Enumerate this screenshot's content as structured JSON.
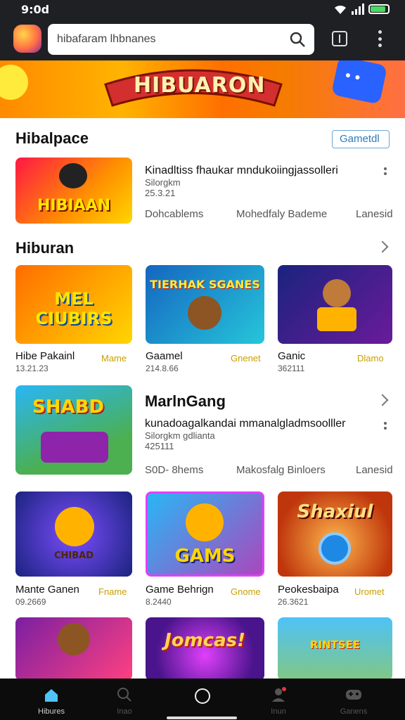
{
  "status_bar": {
    "time": "9:0d"
  },
  "search": {
    "value": "hibafaram lhbnanes"
  },
  "hero": {
    "title": "HIBUARON"
  },
  "section1": {
    "title": "Hibalpace",
    "action_label": "Gametdl",
    "featured": {
      "thumb_text": "HIBIAAN",
      "title": "Kinadltiss fhaukar mndukoiingjassolleri",
      "subtitle": "Silorgkm",
      "meta": "25.3.21",
      "stats": [
        "Dohcablems",
        "Mohedfaly Bademe",
        "Lanesid"
      ]
    }
  },
  "section2": {
    "title": "Hiburan",
    "cards": [
      {
        "thumb_text": "MEL CIUBIRS",
        "name": "Hibe Pakainl",
        "meta": "13.21.23",
        "tag": "Mame",
        "bg": "#ff6d00"
      },
      {
        "thumb_text": "TIERHAK SGANES",
        "name": "Gaamel",
        "meta": "214.8.66",
        "tag": "Gnenet",
        "bg": "#1e88e5"
      },
      {
        "thumb_text": "",
        "name": "Ganic",
        "meta": "362111",
        "tag": "Dlamo",
        "bg": "#283593"
      }
    ]
  },
  "section3": {
    "title": "MarlnGang",
    "featured": {
      "thumb_text": "SHABD",
      "title": "kunadoagalkandai mmanalgladmsoolller",
      "subtitle": "Silorgkm gdlianta",
      "meta": "425111",
      "stats": [
        "S0D- 8hems",
        "Makosfalg Binloers",
        "Lanesid"
      ]
    }
  },
  "section4": {
    "cards": [
      {
        "thumb_text": "CHIBAD",
        "name": "Mante Ganen",
        "meta": "09.2669",
        "tag": "Fname",
        "bg": "#3949ab"
      },
      {
        "thumb_text": "GAMS",
        "name": "Game Behrign",
        "meta": "8.2440",
        "tag": "Gnome",
        "bg": "#29b6f6"
      },
      {
        "thumb_text": "Shaxiul",
        "name": "Peokesbaipa",
        "meta": "26.3621",
        "tag": "Uromet",
        "bg": "#e64a19"
      }
    ]
  },
  "section5": {
    "cards": [
      {
        "thumb_text": "",
        "bg": "#7b1fa2"
      },
      {
        "thumb_text": "Jomcas!",
        "bg": "#4a148c"
      },
      {
        "thumb_text": "RINTSEE",
        "bg": "#29b6f6"
      }
    ]
  },
  "bottom_nav": {
    "items": [
      {
        "label": "Hibures",
        "icon": "home-icon"
      },
      {
        "label": "Inao",
        "icon": "search-icon"
      },
      {
        "label": "",
        "icon": "circle-icon"
      },
      {
        "label": "Inun",
        "icon": "person-icon"
      },
      {
        "label": "Ganens",
        "icon": "gamepad-icon"
      }
    ]
  },
  "colors": {
    "accent": "#2f7bb8",
    "tag": "#c8a000",
    "nav_bg": "#0c0c0c",
    "top_bg": "#1f2024"
  }
}
